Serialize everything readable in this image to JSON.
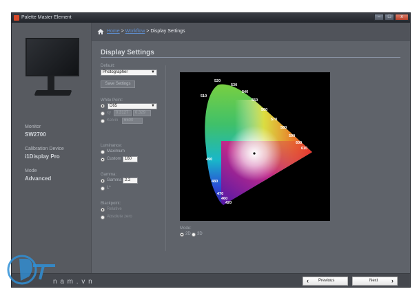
{
  "window": {
    "title": "Palette Master Element",
    "controls": {
      "minimize": "–",
      "maximize": "□",
      "close": "x"
    }
  },
  "sidebar": {
    "monitor_label": "Monitor",
    "monitor_value": "SW2700",
    "device_label": "Calibration Device",
    "device_value": "i1Display Pro",
    "mode_label": "Mode",
    "mode_value": "Advanced"
  },
  "breadcrumb": {
    "home": "Home",
    "sep1": " > ",
    "workflow": "Workflow",
    "sep2": " > ",
    "current": "Display Settings"
  },
  "page": {
    "title": "Display Settings"
  },
  "settings": {
    "default_label": "Default:",
    "default_value": "Photographer",
    "save_button": "Save Settings",
    "white_point_label": "White Point:",
    "wp_d_value": "D65",
    "wp_xy_label": "xy",
    "wp_x_value": "0.3127",
    "wp_y_value": "0.329",
    "wp_kelvin_label": "Kelvin",
    "wp_kelvin_value": "6500",
    "luminance_label": "Luminance:",
    "lum_maximum": "Maximum",
    "lum_custom": "Custom",
    "lum_custom_value": "160",
    "gamma_label": "Gamma:",
    "gamma_option": "Gamma",
    "gamma_value": "2.2",
    "gamma_lstar": "L*",
    "blackpoint_label": "Blackpoint:",
    "bp_relative": "Relative",
    "bp_absolute": "Absolute zero"
  },
  "chart": {
    "mode_label": "Mode:",
    "mode_2d": "2D",
    "mode_3d": "3D",
    "wavelength_labels": [
      {
        "label": "520"
      },
      {
        "label": "530"
      },
      {
        "label": "540"
      },
      {
        "label": "550"
      },
      {
        "label": "560"
      },
      {
        "label": "570"
      },
      {
        "label": "580"
      },
      {
        "label": "590"
      },
      {
        "label": "600"
      },
      {
        "label": "610"
      },
      {
        "label": "510"
      },
      {
        "label": "490"
      },
      {
        "label": "480"
      },
      {
        "label": "470"
      },
      {
        "label": "460"
      },
      {
        "label": "420"
      }
    ]
  },
  "footer": {
    "brand": "n a m . v n",
    "previous": "Previous",
    "next": "Next"
  },
  "colors": {
    "accent_link": "#5f8fd0",
    "panel_bg": "#5f636a",
    "sidebar_bg": "#575a60"
  }
}
